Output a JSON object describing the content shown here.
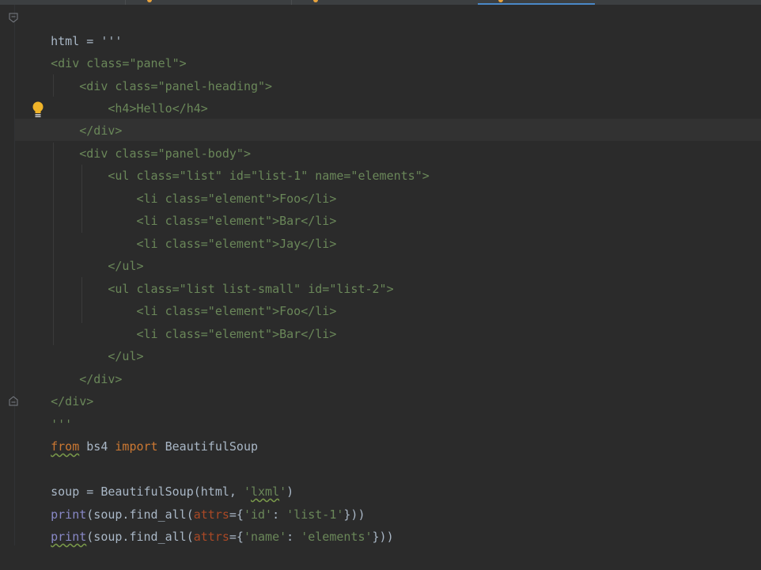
{
  "editor": {
    "lines": [
      {
        "t": "html = '''"
      },
      {
        "t": "<div class=\"panel\">"
      },
      {
        "t": "    <div class=\"panel-heading\">"
      },
      {
        "t": "        <h4>Hello</h4>"
      },
      {
        "t": "    </div>"
      },
      {
        "t": "    <div class=\"panel-body\">"
      },
      {
        "t": "        <ul class=\"list\" id=\"list-1\" name=\"elements\">"
      },
      {
        "t": "            <li class=\"element\">Foo</li>"
      },
      {
        "t": "            <li class=\"element\">Bar</li>"
      },
      {
        "t": "            <li class=\"element\">Jay</li>"
      },
      {
        "t": "        </ul>"
      },
      {
        "t": "        <ul class=\"list list-small\" id=\"list-2\">"
      },
      {
        "t": "            <li class=\"element\">Foo</li>"
      },
      {
        "t": "            <li class=\"element\">Bar</li>"
      },
      {
        "t": "        </ul>"
      },
      {
        "t": "    </div>"
      },
      {
        "t": "</div>"
      },
      {
        "t": "'''"
      },
      {
        "t": ""
      },
      {
        "t": "from bs4 import BeautifulSoup"
      },
      {
        "t": ""
      },
      {
        "t": "soup = BeautifulSoup(html, 'lxml')"
      },
      {
        "t": "print(soup.find_all(attrs={'id': 'list-1'}))"
      },
      {
        "t": "print(soup.find_all(attrs={'name': 'elements'}))"
      }
    ],
    "colors": {
      "background": "#2b2b2b",
      "default_text": "#a9b7c6",
      "string": "#6a8759",
      "keyword": "#cc7832",
      "builtin": "#8888c6",
      "parameter": "#aa4926",
      "intention_bulb": "#f0b429"
    },
    "icons": {
      "fold_start": "fold-start-icon",
      "fold_end": "fold-end-icon",
      "intention": "lightbulb-icon"
    }
  }
}
